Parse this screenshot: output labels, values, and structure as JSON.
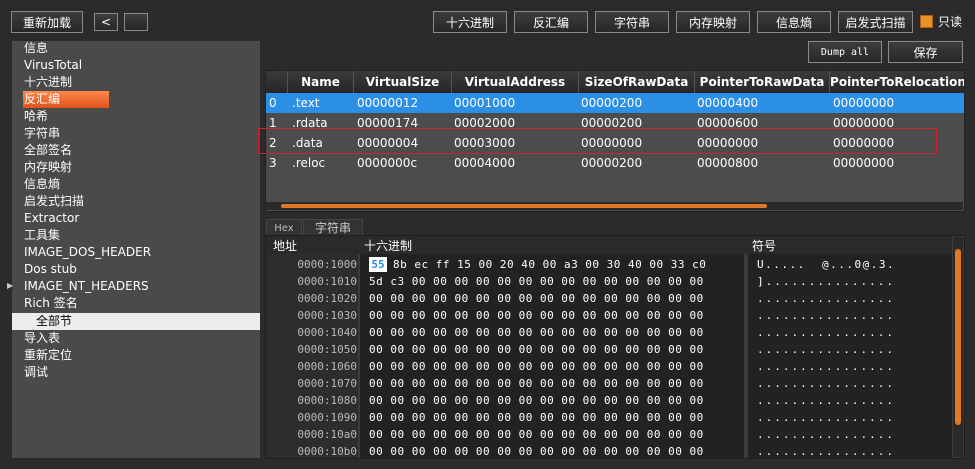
{
  "toolbar": {
    "reload_label": "重新加载",
    "back_glyph": "<",
    "forward_glyph": "",
    "tabs": [
      "十六进制",
      "反汇编",
      "字符串",
      "内存映射",
      "信息熵",
      "启发式扫描"
    ],
    "readonly_label": "只读",
    "dump_all_label": "Dump all",
    "save_label": "保存"
  },
  "sidebar": {
    "items": [
      "信息",
      "VirusTotal",
      "十六进制",
      "反汇编",
      "哈希",
      "字符串",
      "全部签名",
      "内存映射",
      "信息熵",
      "启发式扫描",
      "Extractor",
      "工具集",
      "IMAGE_DOS_HEADER",
      "Dos stub",
      "IMAGE_NT_HEADERS",
      "Rich 签名",
      "全部节",
      "导入表",
      "重新定位",
      "调试"
    ],
    "expander_glyph": "▶"
  },
  "sections": {
    "columns": [
      "",
      "Name",
      "VirtualSize",
      "VirtualAddress",
      "SizeOfRawData",
      "PointerToRawData",
      "PointerToRelocation"
    ],
    "rows": [
      [
        "0",
        ".text",
        "00000012",
        "00001000",
        "00000200",
        "00000400",
        "00000000"
      ],
      [
        "1",
        ".rdata",
        "00000174",
        "00002000",
        "00000200",
        "00000600",
        "00000000"
      ],
      [
        "2",
        ".data",
        "00000004",
        "00003000",
        "00000000",
        "00000000",
        "00000000"
      ],
      [
        "3",
        ".reloc",
        "0000000c",
        "00004000",
        "00000200",
        "00000800",
        "00000000"
      ]
    ]
  },
  "hex_tabs": [
    "Hex",
    "字符串"
  ],
  "hex": {
    "header_address": "地址",
    "header_hex": "十六进制",
    "header_symbol": "符号",
    "cursor_byte": "55",
    "rows": [
      {
        "addr": "0000:1000",
        "hex": "8b ec ff 15 00 20 40 00 a3 00 30 40 00 33 c0",
        "sym": "U.....  @...0@.3."
      },
      {
        "addr": "0000:1010",
        "hex": "5d c3 00 00 00 00 00 00 00 00 00 00 00 00 00 00",
        "sym": "]..............."
      },
      {
        "addr": "0000:1020",
        "hex": "00 00 00 00 00 00 00 00 00 00 00 00 00 00 00 00",
        "sym": "................"
      },
      {
        "addr": "0000:1030",
        "hex": "00 00 00 00 00 00 00 00 00 00 00 00 00 00 00 00",
        "sym": "................"
      },
      {
        "addr": "0000:1040",
        "hex": "00 00 00 00 00 00 00 00 00 00 00 00 00 00 00 00",
        "sym": "................"
      },
      {
        "addr": "0000:1050",
        "hex": "00 00 00 00 00 00 00 00 00 00 00 00 00 00 00 00",
        "sym": "................"
      },
      {
        "addr": "0000:1060",
        "hex": "00 00 00 00 00 00 00 00 00 00 00 00 00 00 00 00",
        "sym": "................"
      },
      {
        "addr": "0000:1070",
        "hex": "00 00 00 00 00 00 00 00 00 00 00 00 00 00 00 00",
        "sym": "................"
      },
      {
        "addr": "0000:1080",
        "hex": "00 00 00 00 00 00 00 00 00 00 00 00 00 00 00 00",
        "sym": "................"
      },
      {
        "addr": "0000:1090",
        "hex": "00 00 00 00 00 00 00 00 00 00 00 00 00 00 00 00",
        "sym": "................"
      },
      {
        "addr": "0000:10a0",
        "hex": "00 00 00 00 00 00 00 00 00 00 00 00 00 00 00 00",
        "sym": "................"
      },
      {
        "addr": "0000:10b0",
        "hex": "00 00 00 00 00 00 00 00 00 00 00 00 00 00 00 00",
        "sym": "................"
      }
    ]
  },
  "colors": {
    "accent": "#e07828",
    "selection": "#2b8fe6",
    "highlight_box": "#c62828"
  }
}
